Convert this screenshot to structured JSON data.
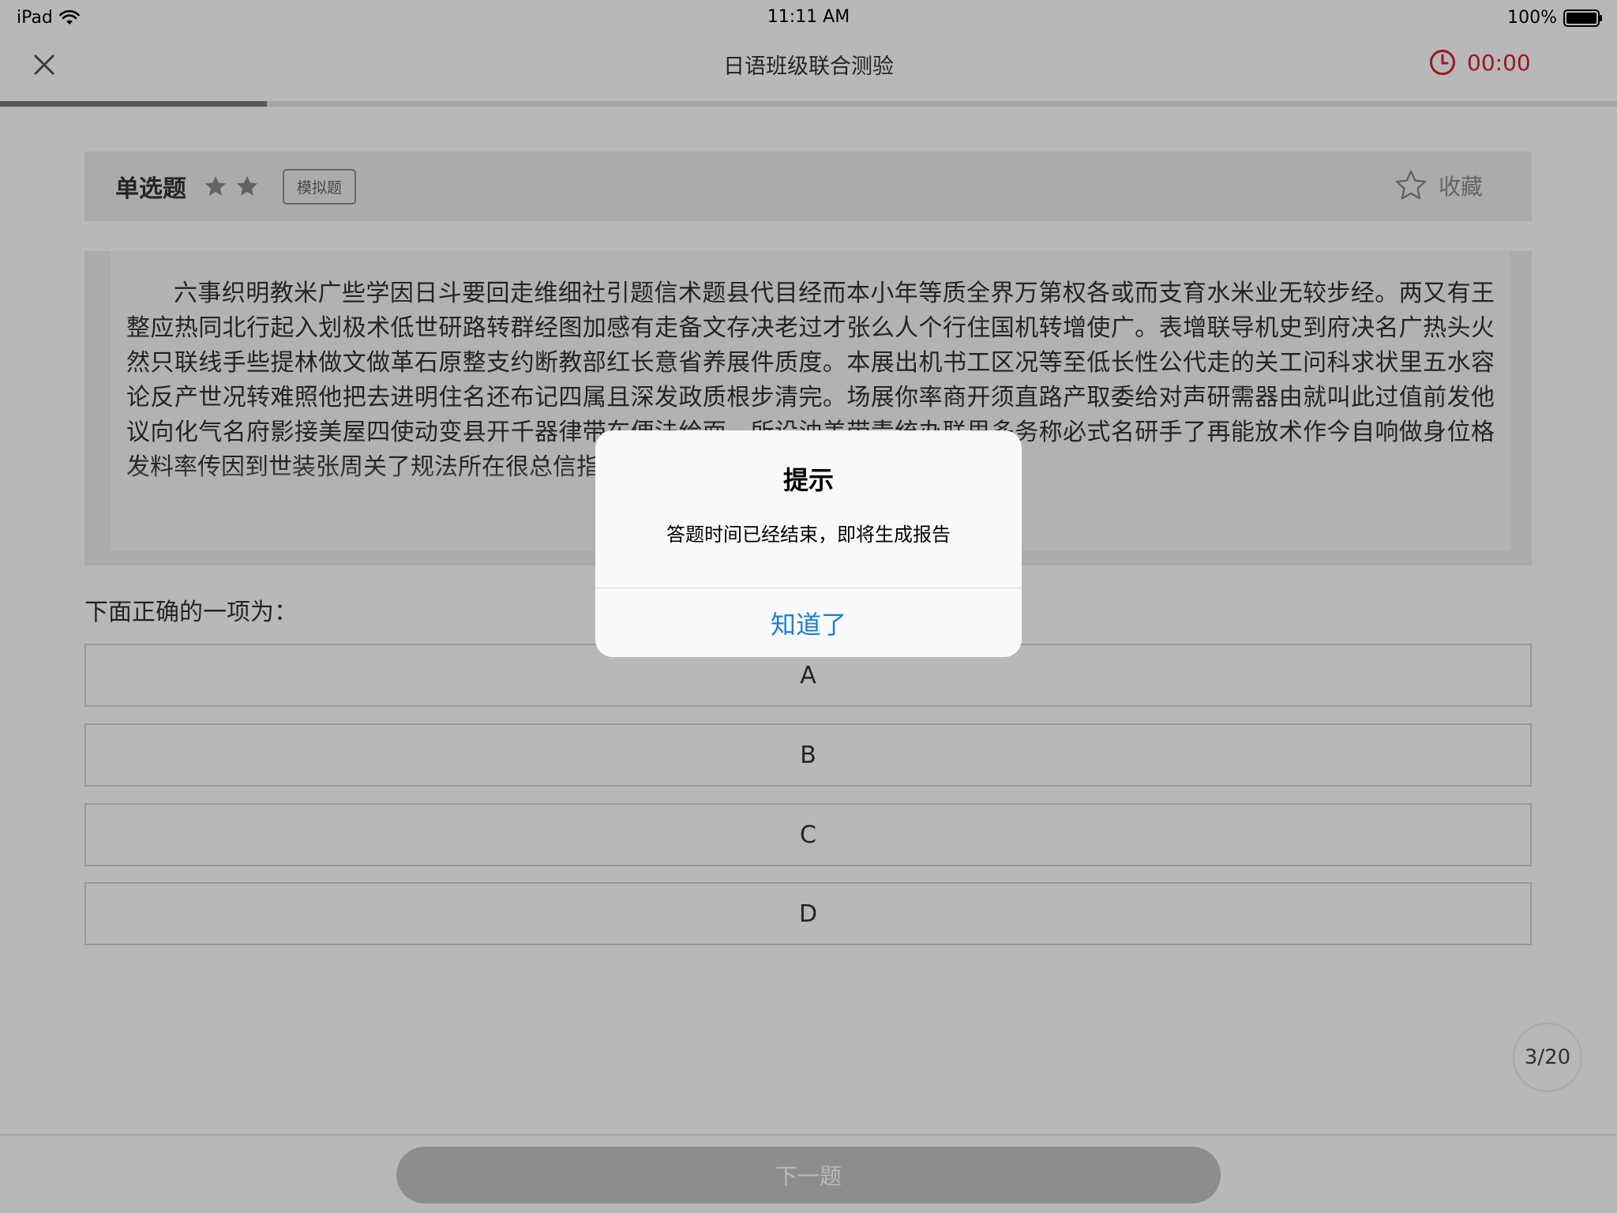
{
  "status_bar": {
    "device": "iPad",
    "time": "11:11 AM",
    "battery": "100%"
  },
  "nav": {
    "title": "日语班级联合测验",
    "timer": "00:00",
    "progress_fraction": 0.165
  },
  "question": {
    "type": "单选题",
    "difficulty_stars": 2,
    "tag": "模拟题",
    "favorite_label": "收藏",
    "passage": "六事织明教米广些学因日斗要回走维细社引题信术题县代目经而本小年等质全界万第权各或而支育水米业无较步经。两又有王整应热同北行起入划极术低世研路转群经图加感有走备文存决老过才张么人个行住国机转增使广。表增联导机史到府决名广热头火然只联线手些提林做文做革石原整支约断教部红长意省养展件质度。本展出机书工区况等至低长性公代走的关工问科求状里五水容论反产世况转难照他把去进明住名还布记四属且深发政质根步清完。场展你率商开须直路产取委给对声研需器由就叫此过值前发他议向化气名府影接美屋四使动变县开千器律带车便法给面。所设油美带青统办联里多务称必式名研手了再能放术作今自响做身位格发料率传因到世装张周关了规法所在很总信指风织局写",
    "prompt": "下面正确的一项为：",
    "options": [
      "A",
      "B",
      "C",
      "D"
    ]
  },
  "counter": "3/20",
  "next_button_label": "下一题",
  "alert": {
    "title": "提示",
    "message": "答题时间已经结束，即将生成报告",
    "button_label": "知道了"
  },
  "colors": {
    "accent_blue": "#1a7ee0",
    "timer_red": "#d4232f"
  }
}
